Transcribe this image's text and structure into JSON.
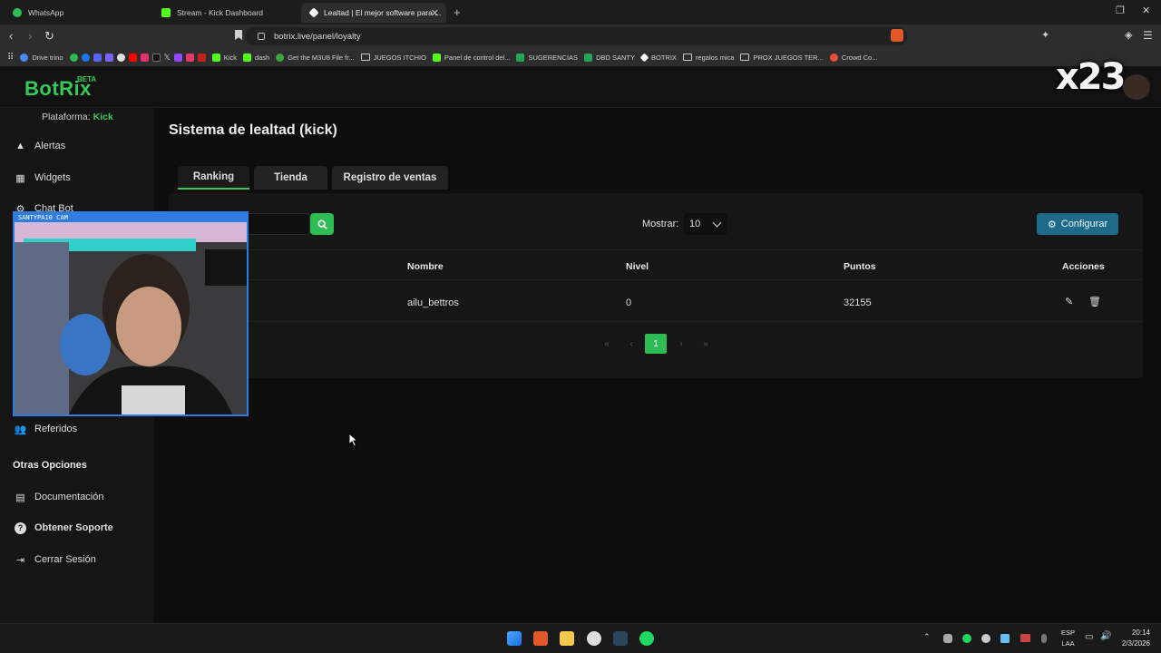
{
  "browser": {
    "tabs": [
      {
        "label": "WhatsApp",
        "color": "#2ebd54"
      },
      {
        "label": "Stream - Kick Dashboard",
        "color": "#53fc18"
      },
      {
        "label": "Lealtad | El mejor software para ...",
        "color": "#ffffff"
      }
    ],
    "url": "botrix.live/panel/loyalty",
    "bookmarks": [
      "Drive trino",
      "Kick",
      "dash",
      "Get the M3U8 File fr...",
      "JUEGOS ITCHIO",
      "Panel de control del...",
      "SUGERENCIAS",
      "DBD SANTY",
      "BOTRIX",
      "regalos mica",
      "PROX JUEGOS TER...",
      "Crowd Co..."
    ]
  },
  "app": {
    "logo": "BotRix",
    "beta": "BETA",
    "accent": "#36c95a",
    "platform_label": "Plataforma:",
    "platform_value": "Kick",
    "sidebar": {
      "items": [
        {
          "label": "Alertas",
          "icon": "warning-icon"
        },
        {
          "label": "Widgets",
          "icon": "grid-icon"
        },
        {
          "label": "Chat Bot",
          "icon": "robot-icon"
        },
        {
          "label": "Referidos",
          "icon": "users-icon"
        }
      ],
      "other_heading": "Otras Opciones",
      "other_items": [
        {
          "label": "Documentación",
          "icon": "book-icon"
        },
        {
          "label": "Obtener Soporte",
          "icon": "help-icon"
        },
        {
          "label": "Cerrar Sesión",
          "icon": "logout-icon"
        }
      ]
    },
    "page_title": "Sistema de lealtad (kick)",
    "tabs": [
      "Ranking",
      "Tienda",
      "Registro de ventas"
    ],
    "active_tab": "Ranking",
    "show_label": "Mostrar:",
    "show_value": "10",
    "config_label": "Configurar",
    "table": {
      "headers": [
        "Nombre",
        "Nivel",
        "Puntos",
        "Acciones"
      ],
      "rows": [
        {
          "nombre": "ailu_bettros",
          "nivel": "0",
          "puntos": "32155"
        }
      ]
    },
    "pagination": {
      "current": "1"
    }
  },
  "overlay": {
    "cam_title": "SANTYPA10 CAM",
    "counter": "x23"
  },
  "taskbar": {
    "lang_top": "ESP",
    "lang_bottom": "LAA",
    "time": "20:14",
    "date": "2/3/2026"
  }
}
